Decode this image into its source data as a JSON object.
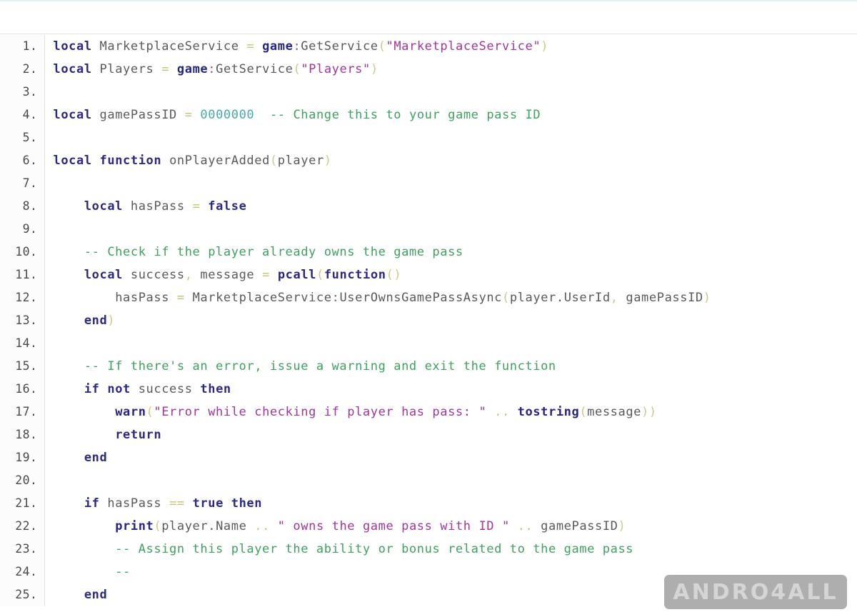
{
  "editor": {
    "language": "Lua",
    "first_line": 1,
    "last_visible_line": 25,
    "colors": {
      "background": "#ffffff",
      "gutter_background": "#fcfcfc",
      "gutter_border": "#e0e4e8",
      "line_number": "#4a4a4a",
      "keyword": "#2b2b80",
      "builtin": "#262680",
      "string": "#a0369c",
      "comment": "#40a060",
      "number": "#4aa8a8",
      "operator": "#c8c070",
      "identifier": "#5a5a5a"
    }
  },
  "watermark": {
    "text": "ANDRO4ALL",
    "background": "#a8a8a8",
    "color": "#d2d2d2"
  },
  "lines": [
    {
      "n": "1.",
      "tokens": [
        {
          "t": "local",
          "c": "kw"
        },
        {
          "t": " ",
          "c": "id"
        },
        {
          "t": "MarketplaceService",
          "c": "id"
        },
        {
          "t": " ",
          "c": "id"
        },
        {
          "t": "=",
          "c": "op"
        },
        {
          "t": " ",
          "c": "id"
        },
        {
          "t": "game",
          "c": "bi"
        },
        {
          "t": ":",
          "c": "col"
        },
        {
          "t": "GetService",
          "c": "id"
        },
        {
          "t": "(",
          "c": "pun"
        },
        {
          "t": "\"MarketplaceService\"",
          "c": "str"
        },
        {
          "t": ")",
          "c": "pun"
        }
      ]
    },
    {
      "n": "2.",
      "tokens": [
        {
          "t": "local",
          "c": "kw"
        },
        {
          "t": " ",
          "c": "id"
        },
        {
          "t": "Players",
          "c": "id"
        },
        {
          "t": " ",
          "c": "id"
        },
        {
          "t": "=",
          "c": "op"
        },
        {
          "t": " ",
          "c": "id"
        },
        {
          "t": "game",
          "c": "bi"
        },
        {
          "t": ":",
          "c": "col"
        },
        {
          "t": "GetService",
          "c": "id"
        },
        {
          "t": "(",
          "c": "pun"
        },
        {
          "t": "\"Players\"",
          "c": "str"
        },
        {
          "t": ")",
          "c": "pun"
        }
      ]
    },
    {
      "n": "3.",
      "tokens": []
    },
    {
      "n": "4.",
      "tokens": [
        {
          "t": "local",
          "c": "kw"
        },
        {
          "t": " ",
          "c": "id"
        },
        {
          "t": "gamePassID",
          "c": "id"
        },
        {
          "t": " ",
          "c": "id"
        },
        {
          "t": "=",
          "c": "op"
        },
        {
          "t": " ",
          "c": "id"
        },
        {
          "t": "0000000",
          "c": "num"
        },
        {
          "t": "  ",
          "c": "id"
        },
        {
          "t": "-- Change this to your game pass ID",
          "c": "com"
        }
      ]
    },
    {
      "n": "5.",
      "tokens": []
    },
    {
      "n": "6.",
      "tokens": [
        {
          "t": "local",
          "c": "kw"
        },
        {
          "t": " ",
          "c": "id"
        },
        {
          "t": "function",
          "c": "kw"
        },
        {
          "t": " ",
          "c": "id"
        },
        {
          "t": "onPlayerAdded",
          "c": "id"
        },
        {
          "t": "(",
          "c": "pun"
        },
        {
          "t": "player",
          "c": "id"
        },
        {
          "t": ")",
          "c": "pun"
        }
      ]
    },
    {
      "n": "7.",
      "tokens": []
    },
    {
      "n": "8.",
      "tokens": [
        {
          "t": "    ",
          "c": "id"
        },
        {
          "t": "local",
          "c": "kw"
        },
        {
          "t": " ",
          "c": "id"
        },
        {
          "t": "hasPass",
          "c": "id"
        },
        {
          "t": " ",
          "c": "id"
        },
        {
          "t": "=",
          "c": "op"
        },
        {
          "t": " ",
          "c": "id"
        },
        {
          "t": "false",
          "c": "kw"
        }
      ]
    },
    {
      "n": "9.",
      "tokens": []
    },
    {
      "n": "10.",
      "tokens": [
        {
          "t": "    ",
          "c": "id"
        },
        {
          "t": "-- Check if the player already owns the game pass",
          "c": "com"
        }
      ]
    },
    {
      "n": "11.",
      "tokens": [
        {
          "t": "    ",
          "c": "id"
        },
        {
          "t": "local",
          "c": "kw"
        },
        {
          "t": " ",
          "c": "id"
        },
        {
          "t": "success",
          "c": "id"
        },
        {
          "t": ",",
          "c": "pun"
        },
        {
          "t": " ",
          "c": "id"
        },
        {
          "t": "message",
          "c": "id"
        },
        {
          "t": " ",
          "c": "id"
        },
        {
          "t": "=",
          "c": "op"
        },
        {
          "t": " ",
          "c": "id"
        },
        {
          "t": "pcall",
          "c": "bi"
        },
        {
          "t": "(",
          "c": "pun"
        },
        {
          "t": "function",
          "c": "kw"
        },
        {
          "t": "()",
          "c": "pun"
        }
      ]
    },
    {
      "n": "12.",
      "tokens": [
        {
          "t": "        ",
          "c": "id"
        },
        {
          "t": "hasPass",
          "c": "id"
        },
        {
          "t": " ",
          "c": "id"
        },
        {
          "t": "=",
          "c": "op"
        },
        {
          "t": " ",
          "c": "id"
        },
        {
          "t": "MarketplaceService",
          "c": "id"
        },
        {
          "t": ":",
          "c": "col"
        },
        {
          "t": "UserOwnsGamePassAsync",
          "c": "id"
        },
        {
          "t": "(",
          "c": "pun"
        },
        {
          "t": "player.UserId",
          "c": "id"
        },
        {
          "t": ",",
          "c": "pun"
        },
        {
          "t": " ",
          "c": "id"
        },
        {
          "t": "gamePassID",
          "c": "id"
        },
        {
          "t": ")",
          "c": "pun"
        }
      ]
    },
    {
      "n": "13.",
      "tokens": [
        {
          "t": "    ",
          "c": "id"
        },
        {
          "t": "end",
          "c": "kw"
        },
        {
          "t": ")",
          "c": "pun"
        }
      ]
    },
    {
      "n": "14.",
      "tokens": []
    },
    {
      "n": "15.",
      "tokens": [
        {
          "t": "    ",
          "c": "id"
        },
        {
          "t": "-- If there's an error, issue a warning and exit the function",
          "c": "com"
        }
      ]
    },
    {
      "n": "16.",
      "tokens": [
        {
          "t": "    ",
          "c": "id"
        },
        {
          "t": "if",
          "c": "kw"
        },
        {
          "t": " ",
          "c": "id"
        },
        {
          "t": "not",
          "c": "kw"
        },
        {
          "t": " ",
          "c": "id"
        },
        {
          "t": "success",
          "c": "id"
        },
        {
          "t": " ",
          "c": "id"
        },
        {
          "t": "then",
          "c": "kw"
        }
      ]
    },
    {
      "n": "17.",
      "tokens": [
        {
          "t": "        ",
          "c": "id"
        },
        {
          "t": "warn",
          "c": "bi"
        },
        {
          "t": "(",
          "c": "pun"
        },
        {
          "t": "\"Error while checking if player has pass: \"",
          "c": "str"
        },
        {
          "t": " ",
          "c": "id"
        },
        {
          "t": "..",
          "c": "op"
        },
        {
          "t": " ",
          "c": "id"
        },
        {
          "t": "tostring",
          "c": "bi"
        },
        {
          "t": "(",
          "c": "pun"
        },
        {
          "t": "message",
          "c": "id"
        },
        {
          "t": "))",
          "c": "pun"
        }
      ]
    },
    {
      "n": "18.",
      "tokens": [
        {
          "t": "        ",
          "c": "id"
        },
        {
          "t": "return",
          "c": "kw"
        }
      ]
    },
    {
      "n": "19.",
      "tokens": [
        {
          "t": "    ",
          "c": "id"
        },
        {
          "t": "end",
          "c": "kw"
        }
      ]
    },
    {
      "n": "20.",
      "tokens": []
    },
    {
      "n": "21.",
      "tokens": [
        {
          "t": "    ",
          "c": "id"
        },
        {
          "t": "if",
          "c": "kw"
        },
        {
          "t": " ",
          "c": "id"
        },
        {
          "t": "hasPass",
          "c": "id"
        },
        {
          "t": " ",
          "c": "id"
        },
        {
          "t": "==",
          "c": "op"
        },
        {
          "t": " ",
          "c": "id"
        },
        {
          "t": "true",
          "c": "kw"
        },
        {
          "t": " ",
          "c": "id"
        },
        {
          "t": "then",
          "c": "kw"
        }
      ]
    },
    {
      "n": "22.",
      "tokens": [
        {
          "t": "        ",
          "c": "id"
        },
        {
          "t": "print",
          "c": "bi"
        },
        {
          "t": "(",
          "c": "pun"
        },
        {
          "t": "player.Name",
          "c": "id"
        },
        {
          "t": " ",
          "c": "id"
        },
        {
          "t": "..",
          "c": "op"
        },
        {
          "t": " ",
          "c": "id"
        },
        {
          "t": "\" owns the game pass with ID \"",
          "c": "str"
        },
        {
          "t": " ",
          "c": "id"
        },
        {
          "t": "..",
          "c": "op"
        },
        {
          "t": " ",
          "c": "id"
        },
        {
          "t": "gamePassID",
          "c": "id"
        },
        {
          "t": ")",
          "c": "pun"
        }
      ]
    },
    {
      "n": "23.",
      "tokens": [
        {
          "t": "        ",
          "c": "id"
        },
        {
          "t": "-- Assign this player the ability or bonus related to the game pass",
          "c": "com"
        }
      ]
    },
    {
      "n": "24.",
      "tokens": [
        {
          "t": "        ",
          "c": "id"
        },
        {
          "t": "--",
          "c": "com"
        }
      ]
    },
    {
      "n": "25.",
      "tokens": [
        {
          "t": "    ",
          "c": "id"
        },
        {
          "t": "end",
          "c": "kw"
        }
      ]
    }
  ]
}
